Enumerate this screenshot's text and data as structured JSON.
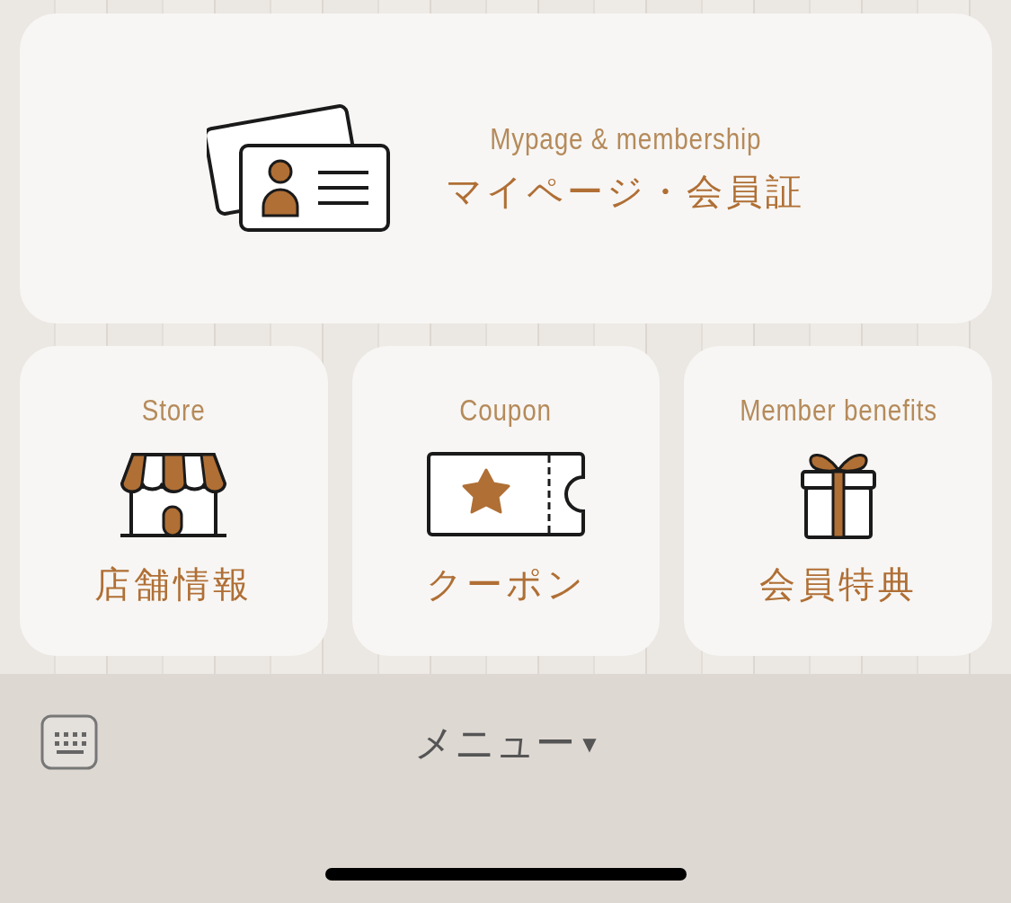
{
  "main_card": {
    "subtitle": "Mypage & membership",
    "title": "マイページ・会員証"
  },
  "tiles": [
    {
      "kind": "store",
      "subtitle": "Store",
      "title": "店舗情報"
    },
    {
      "kind": "coupon",
      "subtitle": "Coupon",
      "title": "クーポン"
    },
    {
      "kind": "gift",
      "subtitle": "Member benefits",
      "title": "会員特典"
    }
  ],
  "menu_bar": {
    "label": "メニュー",
    "caret": "▼"
  }
}
